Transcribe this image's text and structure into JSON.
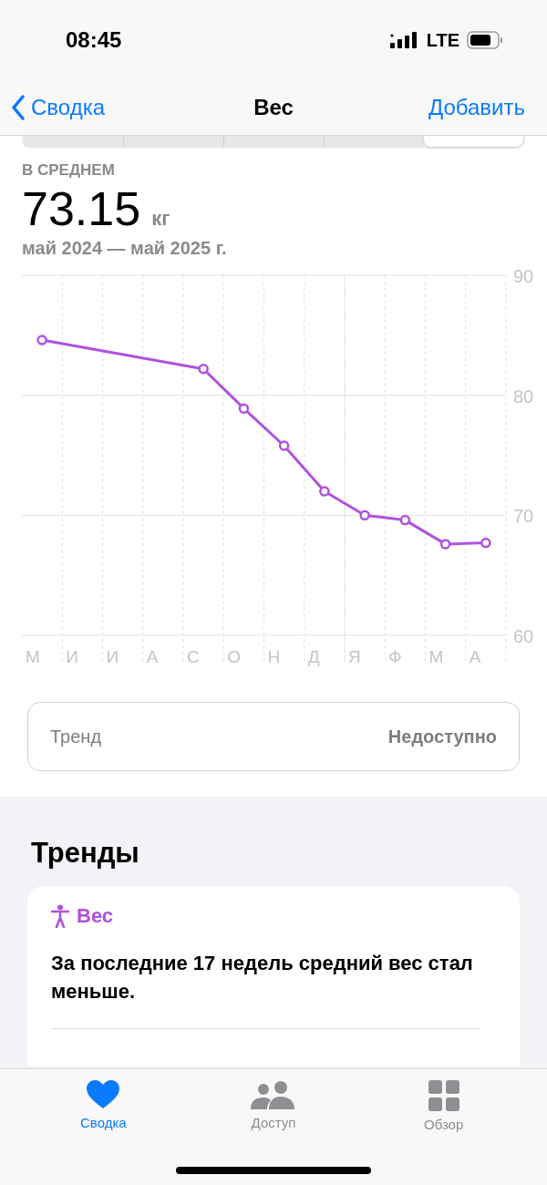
{
  "status_bar": {
    "time": "08:45",
    "network": "LTE"
  },
  "nav": {
    "back": "Сводка",
    "title": "Вес",
    "action": "Добавить"
  },
  "segments": [
    {
      "selected": false
    },
    {
      "selected": false
    },
    {
      "selected": false
    },
    {
      "selected": false
    },
    {
      "selected": true
    }
  ],
  "summary": {
    "label": "В СРЕДНЕМ",
    "value": "73.15",
    "unit": "кг",
    "range": "май 2024 — май 2025 г."
  },
  "chart_data": {
    "type": "line",
    "categories": [
      "М",
      "И",
      "И",
      "А",
      "С",
      "О",
      "Н",
      "Д",
      "Я",
      "Ф",
      "М",
      "А"
    ],
    "ylim": [
      60,
      90
    ],
    "yticks": [
      60,
      70,
      80,
      90
    ],
    "series": [
      {
        "color": "#af52de",
        "marker": "o",
        "values": [
          84.6,
          null,
          null,
          null,
          82.2,
          78.9,
          75.8,
          72.0,
          70.0,
          69.6,
          67.6,
          67.7
        ]
      }
    ]
  },
  "trend_row": {
    "label": "Тренд",
    "value": "Недоступно"
  },
  "trends": {
    "heading": "Тренды",
    "card": {
      "title": "Вес",
      "text": "За последние 17 недель средний вес стал меньше."
    }
  },
  "tab_bar": [
    {
      "label": "Сводка",
      "kind": "heart",
      "selected": true
    },
    {
      "label": "Доступ",
      "kind": "people",
      "selected": false
    },
    {
      "label": "Обзор",
      "kind": "grid",
      "selected": false
    }
  ]
}
